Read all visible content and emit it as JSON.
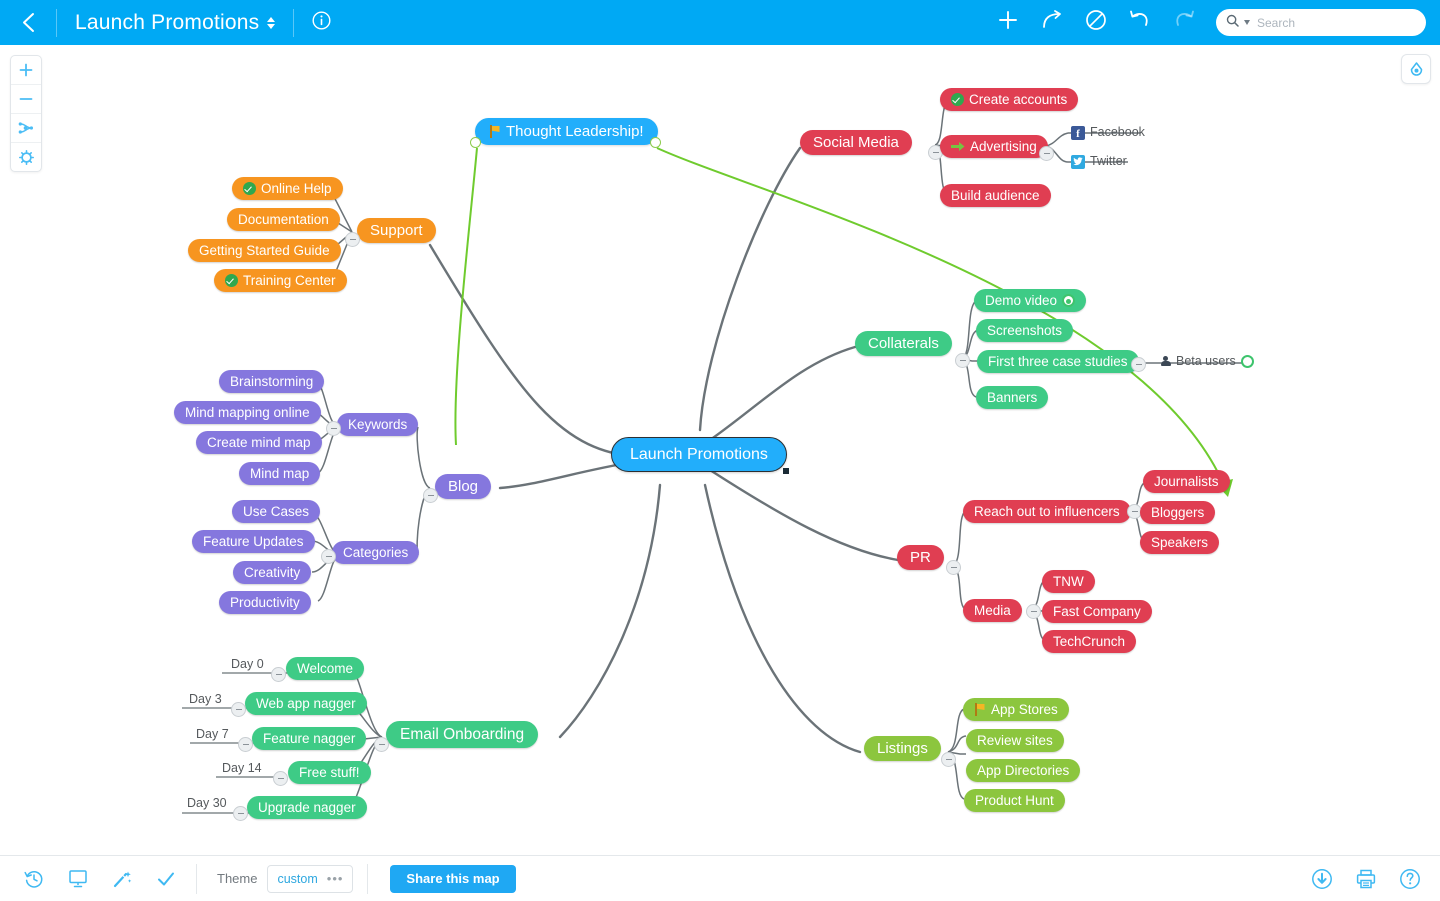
{
  "topbar": {
    "back_icon": "chevron-left-icon",
    "title": "Launch Promotions",
    "title_caret_icon": "updown-caret-icon",
    "info_icon": "info-icon",
    "actions": [
      {
        "name": "add-topic-button",
        "icon": "plus-icon",
        "label": "Add topic"
      },
      {
        "name": "add-subtopic-button",
        "icon": "curved-arrow-icon",
        "label": "Add subtopic"
      },
      {
        "name": "delete-topic-button",
        "icon": "no-entry-icon",
        "label": "Delete"
      },
      {
        "name": "undo-button",
        "icon": "undo-arrow-icon",
        "label": "Undo"
      },
      {
        "name": "redo-button",
        "icon": "redo-arrow-icon",
        "label": "Redo"
      }
    ],
    "search": {
      "icon": "search-icon",
      "placeholder": "Search",
      "value": ""
    }
  },
  "canvas_tools": {
    "zoom_in": "+",
    "zoom_out": "−",
    "fit_icon": "fit-map-icon",
    "settings_icon": "gear-icon",
    "style_panel_icon": "paint-brush-icon"
  },
  "map": {
    "root": {
      "label": "Launch Promotions",
      "color": "#22AEFB",
      "selected": true
    },
    "floating": {
      "label": "Thought Leadership!",
      "color": "#22AEFB",
      "icon": "flag-icon"
    },
    "colors": {
      "root": "#22AEFB",
      "support": "#F79520",
      "blog": "#8577DE",
      "email": "#3ECB86",
      "social": "#E03E52",
      "collaterals": "#3ECB86",
      "pr": "#E03E52",
      "listings": "#8CC63E",
      "relationship_arrow": "#6FCB2E",
      "branch_line": "#6B7378"
    },
    "branches": [
      {
        "name": "support",
        "label": "Support",
        "children": [
          {
            "label": "Online Help",
            "icon": "check-icon"
          },
          {
            "label": "Documentation"
          },
          {
            "label": "Getting Started Guide"
          },
          {
            "label": "Training Center",
            "icon": "check-icon"
          }
        ]
      },
      {
        "name": "blog",
        "label": "Blog",
        "children": [
          {
            "label": "Keywords",
            "children": [
              {
                "label": "Brainstorming"
              },
              {
                "label": "Mind mapping online"
              },
              {
                "label": "Create mind map"
              },
              {
                "label": "Mind map"
              }
            ]
          },
          {
            "label": "Categories",
            "children": [
              {
                "label": "Use Cases"
              },
              {
                "label": "Feature Updates"
              },
              {
                "label": "Creativity"
              },
              {
                "label": "Productivity"
              }
            ]
          }
        ]
      },
      {
        "name": "email-onboarding",
        "label": "Email Onboarding",
        "children": [
          {
            "label": "Welcome",
            "note": "Day 0"
          },
          {
            "label": "Web app nagger",
            "note": "Day 3"
          },
          {
            "label": "Feature nagger",
            "note": "Day 7"
          },
          {
            "label": "Free stuff!",
            "note": "Day 14"
          },
          {
            "label": "Upgrade nagger",
            "note": "Day 30"
          }
        ]
      },
      {
        "name": "social-media",
        "label": "Social Media",
        "children": [
          {
            "label": "Create accounts",
            "icon": "check-icon"
          },
          {
            "label": "Advertising",
            "icon": "green-arrow-icon",
            "children": [
              {
                "label": "Facebook",
                "icon": "facebook-icon"
              },
              {
                "label": "Twitter",
                "icon": "twitter-icon"
              }
            ]
          },
          {
            "label": "Build audience"
          }
        ]
      },
      {
        "name": "collaterals",
        "label": "Collaterals",
        "children": [
          {
            "label": "Demo video",
            "icon": "progress-ring-icon"
          },
          {
            "label": "Screenshots"
          },
          {
            "label": "First three case studies",
            "children": [
              {
                "label": "Beta users",
                "icon": "person-icon",
                "icon2": "progress-ring-icon"
              }
            ]
          },
          {
            "label": "Banners"
          }
        ]
      },
      {
        "name": "pr",
        "label": "PR",
        "children": [
          {
            "label": "Reach out to influencers",
            "children": [
              {
                "label": "Journalists"
              },
              {
                "label": "Bloggers"
              },
              {
                "label": "Speakers"
              }
            ]
          },
          {
            "label": "Media",
            "children": [
              {
                "label": "TNW"
              },
              {
                "label": "Fast Company"
              },
              {
                "label": "TechCrunch"
              }
            ]
          }
        ]
      },
      {
        "name": "listings",
        "label": "Listings",
        "children": [
          {
            "label": "App Stores",
            "icon": "flag-icon"
          },
          {
            "label": "Review sites"
          },
          {
            "label": "App Directories"
          },
          {
            "label": "Product Hunt"
          }
        ]
      }
    ],
    "relationships": [
      {
        "from": "Thought Leadership!",
        "to": "Blog"
      },
      {
        "from": "Thought Leadership!",
        "to": "Reach out to influencers"
      }
    ]
  },
  "bottombar": {
    "tools": [
      {
        "name": "history-button",
        "icon": "history-clock-icon"
      },
      {
        "name": "presentation-button",
        "icon": "presentation-screen-icon"
      },
      {
        "name": "magic-wand-button",
        "icon": "magic-wand-icon"
      },
      {
        "name": "task-check-button",
        "icon": "check-mark-icon"
      }
    ],
    "theme_label": "Theme",
    "theme_value": "custom",
    "theme_dots": "•••",
    "share_label": "Share this map",
    "right_tools": [
      {
        "name": "download-button",
        "icon": "download-circle-icon"
      },
      {
        "name": "print-button",
        "icon": "printer-icon"
      },
      {
        "name": "help-button",
        "icon": "help-circle-icon"
      }
    ]
  }
}
